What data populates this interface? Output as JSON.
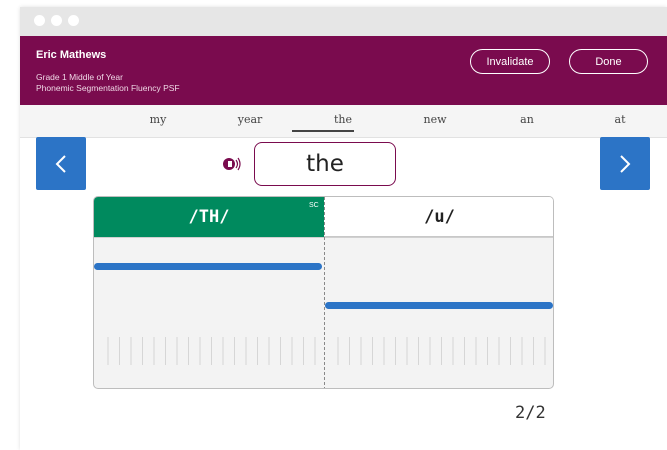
{
  "student": {
    "name": "Eric Mathews",
    "grade_line": "Grade 1  Middle of Year",
    "measure_line": "Phonemic Segmentation Fluency  PSF"
  },
  "actions": {
    "invalidate_label": "Invalidate",
    "done_label": "Done"
  },
  "words": [
    {
      "label": "my"
    },
    {
      "label": "year"
    },
    {
      "label": "the",
      "active": true
    },
    {
      "label": "new"
    },
    {
      "label": "an"
    },
    {
      "label": "at"
    }
  ],
  "target_word": "the",
  "phonemes": [
    {
      "label": "/TH/",
      "marked": true,
      "mark": "SC"
    },
    {
      "label": "/u/",
      "marked": false
    }
  ],
  "page_counter": "2/2",
  "colors": {
    "header_bg": "#7a0b4e",
    "accent_blue": "#2c74c6",
    "phoneme_marked": "#008a5e"
  },
  "icons": {
    "prev": "chevron-left-icon",
    "next": "chevron-right-icon",
    "audio": "speaker-icon"
  }
}
